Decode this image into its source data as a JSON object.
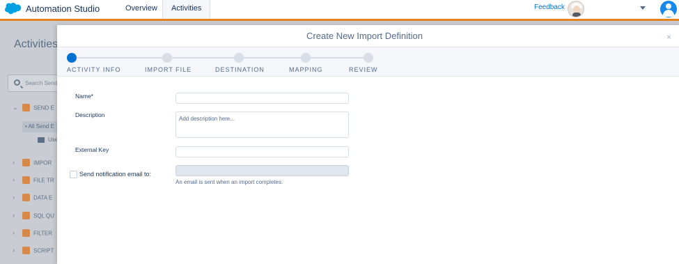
{
  "header": {
    "app_title": "Automation Studio",
    "tabs": [
      {
        "label": "Overview"
      },
      {
        "label": "Activities"
      }
    ],
    "feedback_label": "Feedback",
    "brand_color": "#00a1e0",
    "accent_color": "#e5811f"
  },
  "background": {
    "page_title": "Activities",
    "search_placeholder": "Search Send",
    "tree_items": [
      {
        "label": "SEND E"
      },
      {
        "label": "IMPOR"
      },
      {
        "label": "FILE TR"
      },
      {
        "label": "DATA E"
      },
      {
        "label": "SQL QU"
      },
      {
        "label": "FILTER"
      },
      {
        "label": "SCRIPT"
      }
    ],
    "selected_item": "• All Send E",
    "folder_label": "Use"
  },
  "modal": {
    "title": "Create New Import Definition",
    "close_glyph": "×",
    "steps": [
      {
        "label": "ACTIVITY INFO",
        "active": true
      },
      {
        "label": "IMPORT FILE",
        "active": false
      },
      {
        "label": "DESTINATION",
        "active": false
      },
      {
        "label": "MAPPING",
        "active": false
      },
      {
        "label": "REVIEW",
        "active": false
      }
    ],
    "form": {
      "name_label": "Name*",
      "name_value": "",
      "description_label": "Description",
      "description_placeholder": "Add description here...",
      "external_key_label": "External Key",
      "external_key_value": "",
      "notification_label": "Send notification email to:",
      "notification_checked": false,
      "notification_value": "",
      "notification_help": "An email is sent when an import completes."
    }
  }
}
